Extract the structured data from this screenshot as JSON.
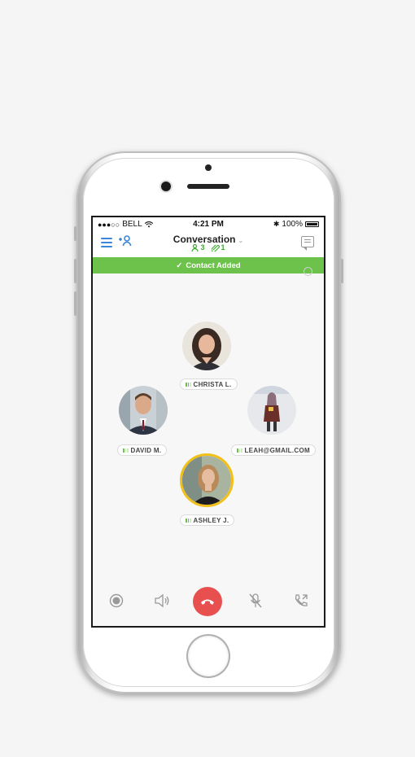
{
  "status_bar": {
    "carrier": "BELL",
    "time": "4:21 PM",
    "battery": "100%"
  },
  "nav": {
    "title": "Conversation",
    "participants_count": "3",
    "attachments_count": "1"
  },
  "banner": {
    "text": "Contact Added"
  },
  "participants": [
    {
      "name": "CHRISTA L.",
      "active_speaker": false
    },
    {
      "name": "DAVID M.",
      "active_speaker": false
    },
    {
      "name": "LEAH@GMAIL.COM",
      "active_speaker": false
    },
    {
      "name": "ASHLEY J.",
      "active_speaker": true
    }
  ],
  "icons": {
    "menu": "menu-icon",
    "add_contact": "add-user-icon",
    "chat": "chat-icon",
    "record": "record-icon",
    "speaker": "speaker-icon",
    "end_call": "end-call-icon",
    "mute": "mute-icon",
    "transfer": "transfer-call-icon"
  },
  "colors": {
    "accent_blue": "#3b86d6",
    "accent_green": "#6cc24a",
    "end_call_red": "#e8504f",
    "active_ring": "#f2c018"
  }
}
